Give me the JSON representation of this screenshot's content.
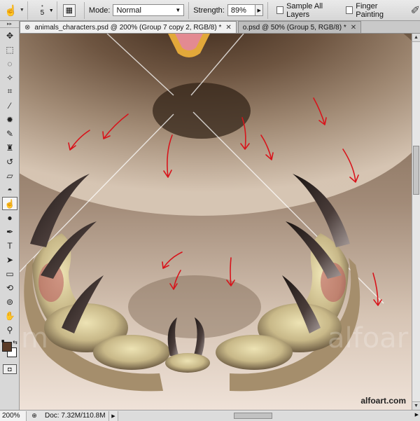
{
  "options_bar": {
    "tool_preset_icon": "smudge-finger-icon",
    "brush_size": "5",
    "mode_label": "Mode:",
    "mode_value": "Normal",
    "strength_label": "Strength:",
    "strength_value": "89%",
    "sample_all_layers_label": "Sample All Layers",
    "sample_all_layers_checked": false,
    "finger_painting_label": "Finger Painting",
    "finger_painting_checked": false
  },
  "tabs": [
    {
      "label": "animals_characters.psd @ 200% (Group 7 copy 2, RGB/8) *",
      "active": true
    },
    {
      "label": "o.psd @ 50% (Group 5, RGB/8) *",
      "active": false
    }
  ],
  "tools": [
    "move-icon",
    "marquee-icon",
    "lasso-icon",
    "quick-select-icon",
    "crop-icon",
    "eyedropper-icon",
    "spot-healing-icon",
    "brush-icon",
    "clone-stamp-icon",
    "history-brush-icon",
    "eraser-icon",
    "paint-bucket-icon",
    "smudge-icon",
    "dodge-icon",
    "pen-icon",
    "type-icon",
    "path-select-icon",
    "rectangle-shape-icon",
    "3d-rotate-icon",
    "3d-orbit-icon",
    "hand-icon",
    "zoom-icon"
  ],
  "active_tool": "smudge-icon",
  "colors": {
    "foreground": "#5a3b27",
    "background": "#ffffff",
    "stroke_arrows": "#d8141b"
  },
  "canvas": {
    "watermark_left": "m",
    "watermark_right": "alfoar",
    "watermark_corner": "alfoart.com"
  },
  "status_bar": {
    "zoom": "200%",
    "doc_info": "Doc: 7.32M/110.8M"
  }
}
